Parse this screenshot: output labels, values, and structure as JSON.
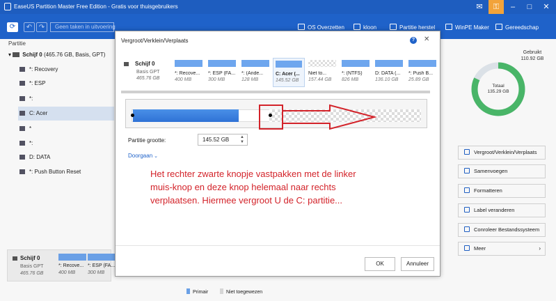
{
  "titlebar": {
    "title": "EaseUS Partition Master Free Edition - Gratis voor thuisgebruikers"
  },
  "toolbar": {
    "pending": "Geen taken in uitvoering",
    "items": [
      "OS Overzetten",
      "kloon",
      "Partitie herstel",
      "WinPE Maker",
      "Gereedschap"
    ]
  },
  "left": {
    "header": "Partitie",
    "disk": {
      "name": "Schijf 0",
      "info": "(465.76 GB, Basis, GPT)"
    },
    "partitions": [
      "*: Recovery",
      "*: ESP",
      "*:",
      "C: Acer",
      "*",
      "*:",
      "D: DATA",
      "*: Push Button Reset"
    ]
  },
  "right": {
    "used_label": "Gebruikt",
    "used_value": "110.92 GB",
    "total_label": "Totaal",
    "total_value": "135.29 GB",
    "used_fraction": 0.82,
    "actions": [
      "Vergroot/Verklein/Verplaats",
      "Samenvoegen",
      "Formatteren",
      "Label veranderen",
      "Conroleer Bestandssysteem",
      "Meer"
    ]
  },
  "bottom": {
    "disk": {
      "name": "Schijf 0",
      "type": "Basis GPT",
      "size": "465.76 GB"
    },
    "parts": [
      {
        "label": "*: Recove...",
        "size": "400 MB"
      },
      {
        "label": "*: ESP (FA...",
        "size": "300 MB"
      }
    ],
    "legend": {
      "primary": "Primair",
      "unallocated": "Niet toegewezen"
    }
  },
  "dialog": {
    "title": "Vergroot/Verklein/Verplaats",
    "disk": {
      "name": "Schijf 0",
      "type": "Basis GPT",
      "size": "465.76 GB"
    },
    "parts": [
      {
        "label": "*: Recove...",
        "size": "400 MB",
        "unallocated": false
      },
      {
        "label": "*: ESP (FA...",
        "size": "300 MB",
        "unallocated": false
      },
      {
        "label": "*: (Ande...",
        "size": "128 MB",
        "unallocated": false
      },
      {
        "label": "C: Acer (...",
        "size": "145.52 GB",
        "unallocated": false,
        "selected": true
      },
      {
        "label": "Niet to...",
        "size": "157.44 GB",
        "unallocated": true
      },
      {
        "label": "*: (NTFS)",
        "size": "826 MB",
        "unallocated": false
      },
      {
        "label": "D: DATA (...",
        "size": "136.10 GB",
        "unallocated": false
      },
      {
        "label": "*: Push B...",
        "size": "25.89 GB",
        "unallocated": false
      }
    ],
    "size_label": "Partitie grootte:",
    "size_value": "145.52 GB",
    "advanced": "Doorgaan",
    "ok": "OK",
    "cancel": "Annuleer"
  },
  "annotation": "Het rechter zwarte knopje vastpakken met de linker muis-knop en deze knop helemaal naar rechts verplaatsen. Hiermee vergroot U de C: partitie...",
  "colors": {
    "accent": "#1f62c9",
    "annotation": "#d3232a",
    "donut": "#4cbb6c",
    "partition": "#6ea6ee"
  }
}
